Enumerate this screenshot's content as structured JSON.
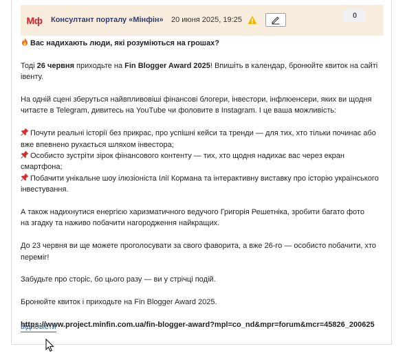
{
  "post": {
    "avatar_text": "Мф",
    "author": "Консултант порталу «Мінфін»",
    "timestamp": "20 июня 2025, 19:25",
    "vote_count": "0",
    "headline": "Вас надихають люди, які розуміються на грошах?",
    "p1_pre": "Тоді ",
    "p1_date": "26 червня",
    "p1_mid": " приходьте на ",
    "p1_event": "Fin Blogger Award 2025",
    "p1_post": "! Впишіть в календар, бронюйте квиток на сайті івенту.",
    "p2": "На одній сцені зберуться найвпливовіші фінансові блогери, інвестори, інфлюенсери, яких ви щодня читаєте в Telegram, дивитесь на YouTube чи фоловите в Instagram. І це ваша можливість:",
    "bullets": [
      "Почути реальні історії без прикрас, про успішні кейси та тренди — для тих, хто тільки починає або вже впевнено рухається шляхом інвестора;",
      "Особисто зустріти зірок фінансового контенту — тих, хто щодня надихає вас через екран смартфона;",
      "Побачити унікальне шоу ілюзіоніста Ілії Кормана та інтерактивну виставку про історію українського інвестування."
    ],
    "p3_line1": "А також надихнутися енергією харизматичного ведучого Григорія Решетніка, зробити багато фото",
    "p3_line2": "на згадку та наживо побачити нагородження найкращих.",
    "p4": "До 23 червня ви ще можете проголосувати за свого фаворита, а вже 26-го — особисто побачити, хто переміг!",
    "p5": "Забудьте про сторіс, бо цього разу — ви у стрічці подій.",
    "p6": "Бронюйте квиток і приходьте на Fin Blogger Award 2025.",
    "url": "https://www.project.minfin.com.ua/fin-blogger-award?mpl=co_nd&mpr=forum&mcr=45826_200625",
    "reply_label": "відповісти"
  },
  "icons": {
    "headline": "fire-icon",
    "bullet": "pushpin-icon",
    "warning": "warning-icon",
    "edit": "pencil-icon"
  },
  "colors": {
    "header_bg": "#f8ecdd",
    "author": "#2f3d6e",
    "avatar": "#d21f26",
    "link": "#2f5ea8"
  }
}
